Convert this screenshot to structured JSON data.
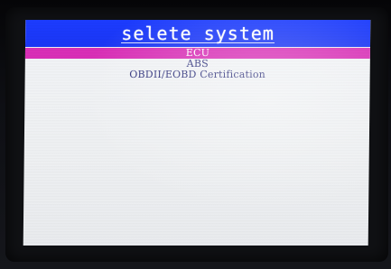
{
  "screen": {
    "title": "selete system",
    "menu": {
      "selected_index": 0,
      "items": [
        {
          "label": "ECU"
        },
        {
          "label": "ABS"
        },
        {
          "label": "OBDII/EOBD Certification"
        }
      ]
    }
  },
  "colors": {
    "title_bar": "#1c3cff",
    "selection_highlight": "#d92fb7",
    "screen_background": "#f2f4f7",
    "menu_text": "#2c2f7a",
    "bezel": "#101114"
  }
}
